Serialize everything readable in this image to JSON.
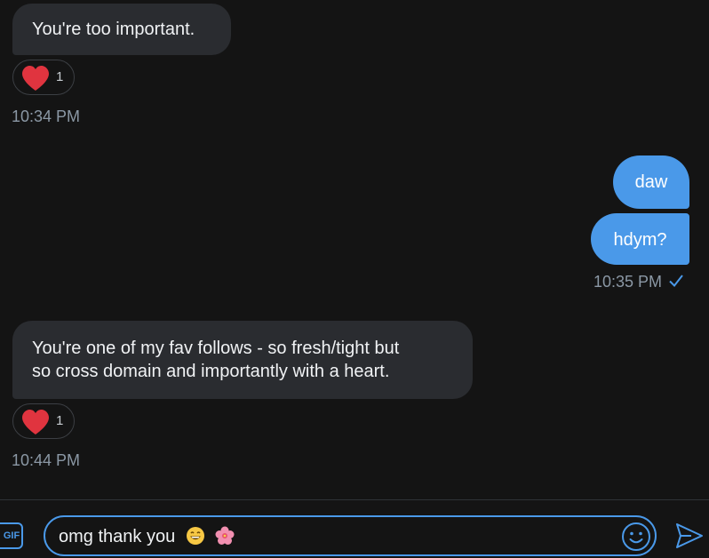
{
  "conversation": {
    "messages": [
      {
        "direction": "incoming",
        "text_lines": [
          "You're too important."
        ],
        "reaction": {
          "emoji": "heart",
          "count": "1"
        },
        "time": "10:34 PM"
      },
      {
        "direction": "outgoing",
        "text": "daw"
      },
      {
        "direction": "outgoing",
        "text": "hdym?",
        "time": "10:35 PM",
        "status": "read-check"
      },
      {
        "direction": "incoming",
        "text_lines": [
          "You're one of my fav follows - so fresh/tight but",
          "so cross domain and importantly with a heart."
        ],
        "reaction": {
          "emoji": "heart",
          "count": "1"
        },
        "time": "10:44 PM"
      }
    ]
  },
  "composer": {
    "gif_label": "GIF",
    "draft_text": "omg thank you",
    "draft_emojis": [
      "grinning-face",
      "hibiscus"
    ],
    "emoji_button_icon": "smiley-icon",
    "send_button_icon": "send-icon"
  },
  "colors": {
    "background": "#141414",
    "incoming_bubble": "#2a2c30",
    "outgoing_bubble": "#4a99e9",
    "accent": "#4a99e9",
    "timestamp": "#8b98a5",
    "heart": "#e0245e"
  }
}
